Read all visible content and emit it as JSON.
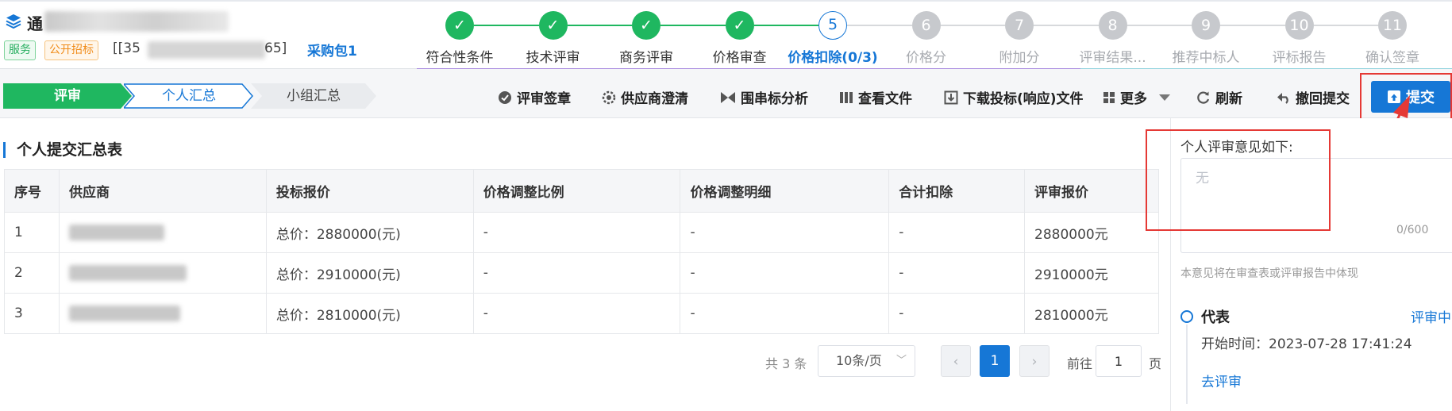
{
  "header": {
    "title": "通",
    "tag_service": "服务",
    "tag_open": "公开招标",
    "code_open": "[[35",
    "code_close": "65]",
    "package": "采购包1"
  },
  "steps": [
    {
      "num": "✓",
      "label": "符合性条件",
      "state": "done"
    },
    {
      "num": "✓",
      "label": "技术评审",
      "state": "done"
    },
    {
      "num": "✓",
      "label": "商务评审",
      "state": "done"
    },
    {
      "num": "✓",
      "label": "价格审查",
      "state": "done"
    },
    {
      "num": "5",
      "label": "价格扣除(0/3)",
      "state": "current"
    },
    {
      "num": "6",
      "label": "价格分",
      "state": "todo"
    },
    {
      "num": "7",
      "label": "附加分",
      "state": "todo"
    },
    {
      "num": "8",
      "label": "评审结果...",
      "state": "todo"
    },
    {
      "num": "9",
      "label": "推荐中标人",
      "state": "todo"
    },
    {
      "num": "10",
      "label": "评标报告",
      "state": "todo"
    },
    {
      "num": "11",
      "label": "确认签章",
      "state": "todo"
    }
  ],
  "toolbar": {
    "crumbs": [
      "评审",
      "个人汇总",
      "小组汇总"
    ],
    "sign": "评审签章",
    "clarify": "供应商澄清",
    "bid_analysis": "围串标分析",
    "view_files": "查看文件",
    "download": "下载投标(响应)文件",
    "more": "更多",
    "refresh": "刷新",
    "withdraw": "撤回提交",
    "submit": "提交"
  },
  "section_title": "个人提交汇总表",
  "table": {
    "headers": [
      "序号",
      "供应商",
      "投标报价",
      "价格调整比例",
      "价格调整明细",
      "合计扣除",
      "评审报价"
    ],
    "rows": [
      {
        "no": "1",
        "bid": "总价：2880000(元)",
        "ratio": "-",
        "detail": "-",
        "deduct": "-",
        "price": "2880000元"
      },
      {
        "no": "2",
        "bid": "总价：2910000(元)",
        "ratio": "-",
        "detail": "-",
        "deduct": "-",
        "price": "2910000元"
      },
      {
        "no": "3",
        "bid": "总价：2810000(元)",
        "ratio": "-",
        "detail": "-",
        "deduct": "-",
        "price": "2810000元"
      }
    ]
  },
  "pagination": {
    "total": "共 3 条",
    "page_size": "10条/页",
    "prev": "‹",
    "current": "1",
    "next": "›",
    "goto_label": "前往",
    "goto_value": "1",
    "goto_suffix": "页"
  },
  "opinion": {
    "label": "个人评审意见如下:",
    "placeholder": "无",
    "count": "0/600",
    "note": "本意见将在审查表或评审报告中体现"
  },
  "representative": {
    "title": "代表",
    "status": "评审中",
    "start_time": "开始时间：2023-07-28 17:41:24",
    "go_review": "去评审"
  },
  "colors": {
    "primary": "#1677d6",
    "success": "#1fb760",
    "annotation": "#e53935"
  }
}
